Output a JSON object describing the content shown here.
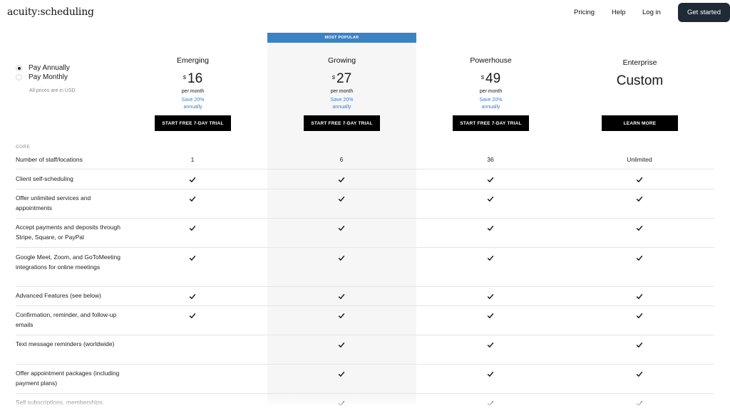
{
  "header": {
    "logo": "acuity:scheduling",
    "nav": [
      "Pricing",
      "Help",
      "Log in"
    ],
    "cta": "Get started"
  },
  "billing": {
    "annual_label": "Pay Annually",
    "monthly_label": "Pay Monthly",
    "selected": "annually",
    "note": "All prices are in USD"
  },
  "popular_label": "MOST POPULAR",
  "plans": [
    {
      "name": "Emerging",
      "currency": "$",
      "price": "16",
      "per": "per month",
      "save1": "Save 20%",
      "save2": "annually",
      "cta": "START FREE 7-DAY TRIAL"
    },
    {
      "name": "Growing",
      "currency": "$",
      "price": "27",
      "per": "per month",
      "save1": "Save 20%",
      "save2": "annually",
      "cta": "START FREE 7-DAY TRIAL"
    },
    {
      "name": "Powerhouse",
      "currency": "$",
      "price": "49",
      "per": "per month",
      "save1": "Save 20%",
      "save2": "annually",
      "cta": "START FREE 7-DAY TRIAL"
    },
    {
      "name": "Enterprise",
      "price_text": "Custom",
      "cta": "LEARN MORE"
    }
  ],
  "section_label": "CORE",
  "features": [
    {
      "label": "Number of staff/locations",
      "values": [
        "1",
        "6",
        "36",
        "Unlimited"
      ]
    },
    {
      "label": "Client self-scheduling",
      "values": [
        true,
        true,
        true,
        true
      ]
    },
    {
      "label": "Offer unlimited services and appointments",
      "values": [
        true,
        true,
        true,
        true
      ]
    },
    {
      "label": "Accept payments and deposits through Stripe, Square, or PayPal",
      "values": [
        true,
        true,
        true,
        true
      ]
    },
    {
      "label": "Google Meet, Zoom, and GoToMeeting integrations for online meetings",
      "values": [
        true,
        true,
        true,
        true
      ]
    },
    {
      "label": "Advanced Features (see below)",
      "values": [
        true,
        true,
        true,
        true
      ]
    },
    {
      "label": "Confirmation, reminder, and follow-up emails",
      "values": [
        true,
        true,
        true,
        true
      ]
    },
    {
      "label": "Text message reminders (worldwide)",
      "values": [
        false,
        true,
        true,
        true
      ]
    },
    {
      "label": "Offer appointment packages (including payment plans)",
      "values": [
        false,
        true,
        true,
        true
      ]
    },
    {
      "label": "Sell subscriptions, memberships,",
      "values": [
        false,
        true,
        true,
        true
      ]
    }
  ],
  "icons": {
    "check": "check-icon",
    "radio": "radio-icon"
  },
  "colors": {
    "accent": "#3b82c4",
    "dark_button": "#1f2a36"
  }
}
